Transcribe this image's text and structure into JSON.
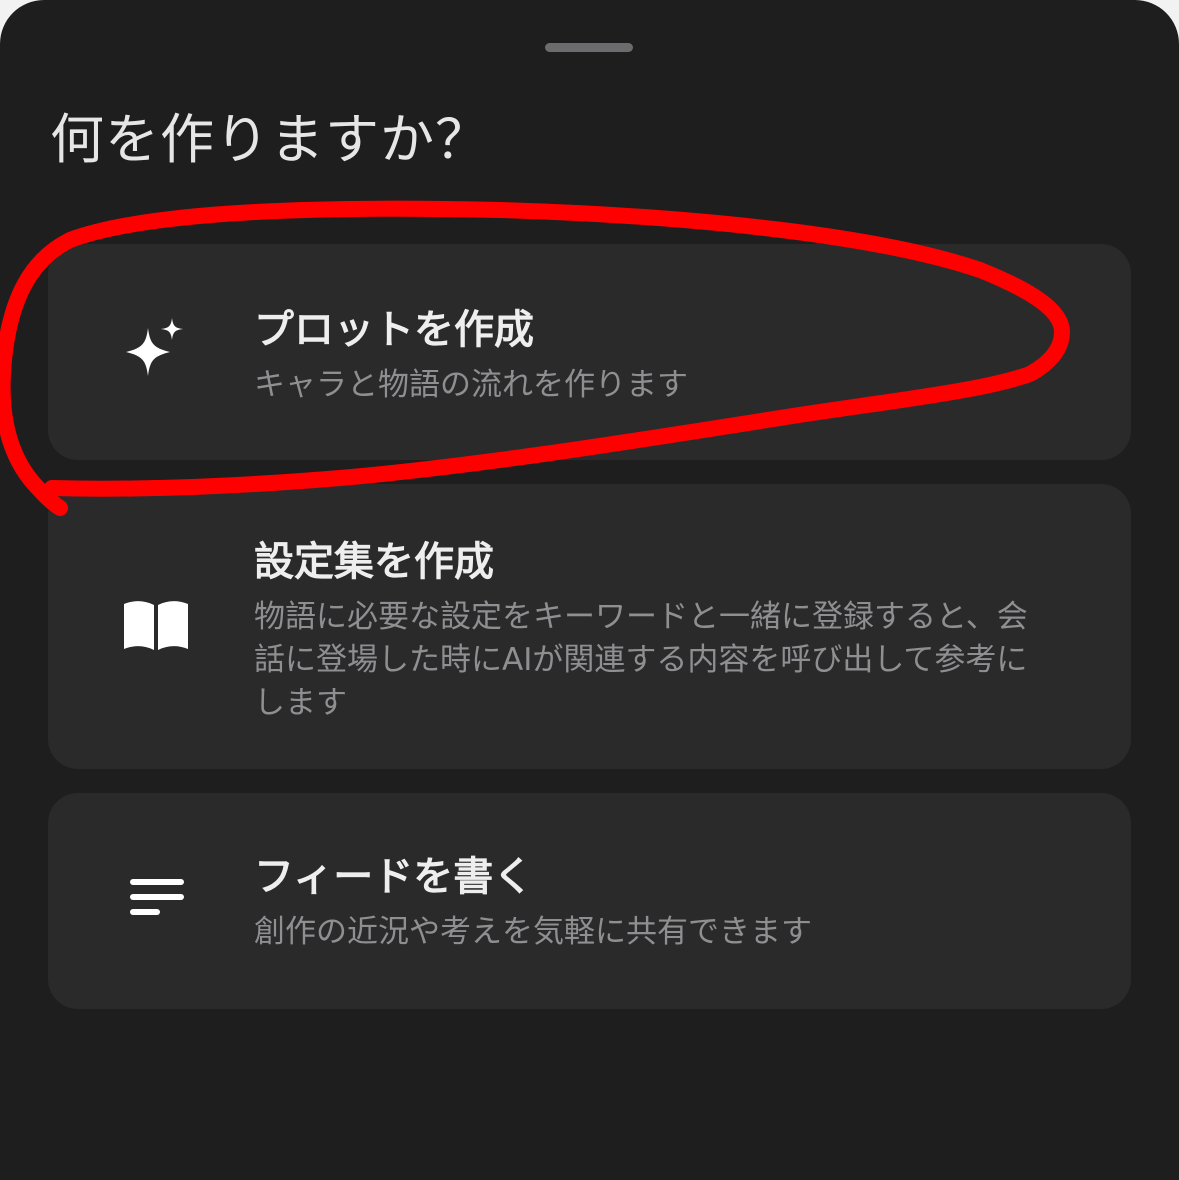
{
  "sheet": {
    "title": "何を作りますか？"
  },
  "options": [
    {
      "title": "プロットを作成",
      "description": "キャラと物語の流れを作ります",
      "icon": "sparkles-icon"
    },
    {
      "title": "設定集を作成",
      "description": "物語に必要な設定をキーワードと一緒に登録すると、会話に登場した時にAIが関連する内容を呼び出して参考にします",
      "icon": "book-open-icon"
    },
    {
      "title": "フィードを書く",
      "description": "創作の近況や考えを気軽に共有できます",
      "icon": "text-lines-icon"
    }
  ],
  "colors": {
    "background": "#1e1e1f",
    "card": "#2a2a2b",
    "title_text": "#eeeeee",
    "description_text": "#8f8f92",
    "annotation": "#ff0000"
  }
}
